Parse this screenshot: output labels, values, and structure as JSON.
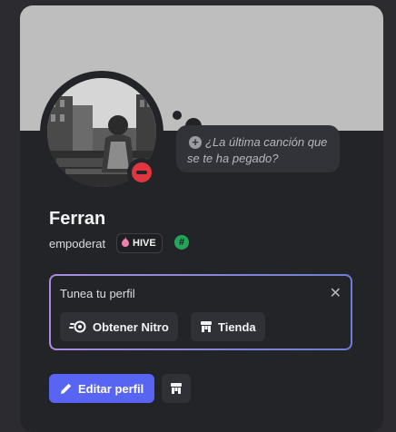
{
  "profile": {
    "display_name": "Ferran",
    "username": "empoderat",
    "status": "dnd",
    "status_color": "#e0363f",
    "banner_color": "#bebebe"
  },
  "custom_status": {
    "placeholder": "¿La última canción que se te ha pegado?",
    "icon": "plus-circle-icon"
  },
  "badges": {
    "guild_tag": "HIVE",
    "guild_tag_icon": "flame-icon",
    "hash_icon": "hash-icon",
    "hash_text": "#",
    "hash_color": "#23a55a"
  },
  "tune_panel": {
    "title": "Tunea tu perfil",
    "close_icon": "close-icon",
    "actions": [
      {
        "label": "Obtener Nitro",
        "icon": "nitro-icon"
      },
      {
        "label": "Tienda",
        "icon": "shop-icon"
      }
    ]
  },
  "buttons": {
    "edit_profile": "Editar perfil",
    "edit_icon": "pencil-icon",
    "shop_icon": "shop-icon",
    "accent": "#5865f2"
  }
}
